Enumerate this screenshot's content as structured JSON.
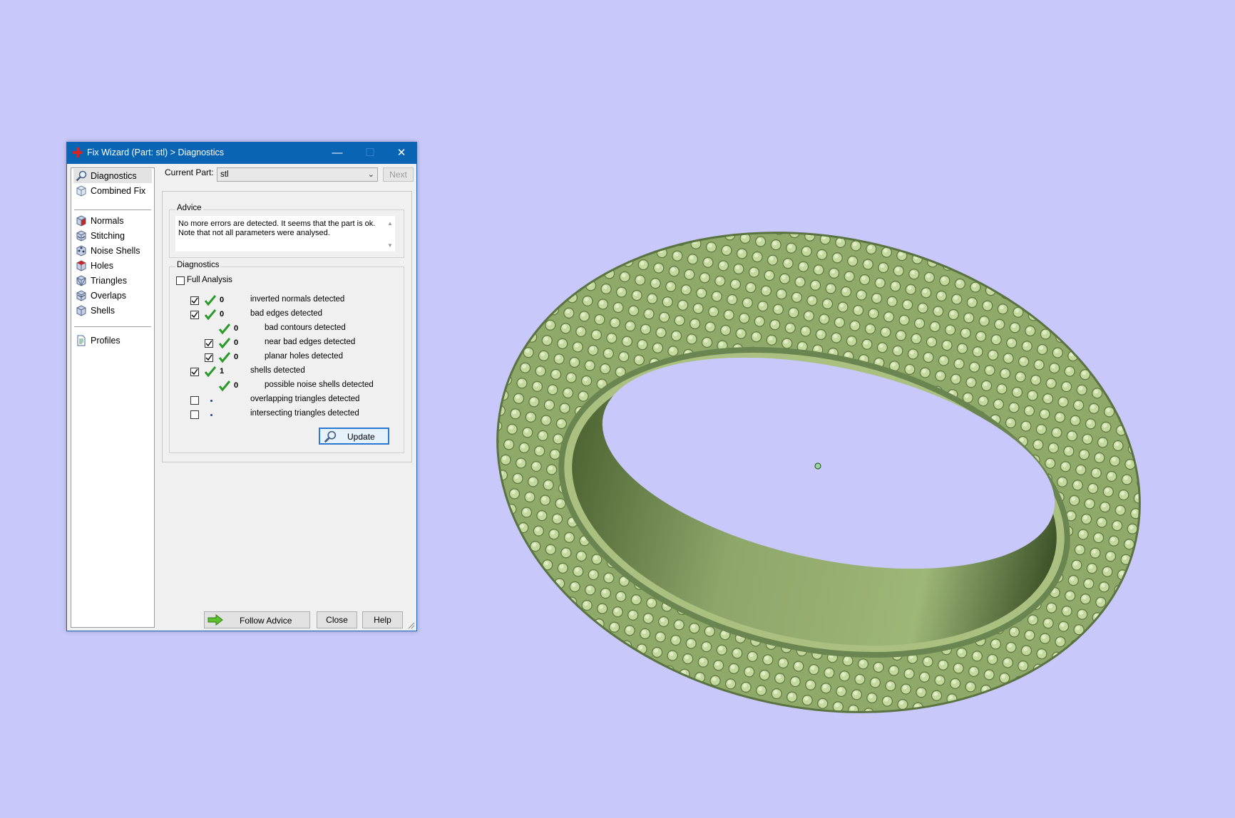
{
  "window": {
    "title": "Fix Wizard (Part: stl) > Diagnostics",
    "min_symbol": "—",
    "max_symbol": "☐",
    "close_symbol": "✕"
  },
  "nav": {
    "items": [
      {
        "label": "Diagnostics",
        "icon": "magnifier-icon",
        "selected": true
      },
      {
        "label": "Combined Fix",
        "icon": "combined-fix-cube-icon"
      },
      {
        "label": "Normals",
        "icon": "normals-cube-icon"
      },
      {
        "label": "Stitching",
        "icon": "stitching-cube-icon"
      },
      {
        "label": "Noise Shells",
        "icon": "noise-shells-cube-icon"
      },
      {
        "label": "Holes",
        "icon": "holes-cube-icon"
      },
      {
        "label": "Triangles",
        "icon": "triangles-cube-icon"
      },
      {
        "label": "Overlaps",
        "icon": "overlaps-cube-icon"
      },
      {
        "label": "Shells",
        "icon": "shells-cube-icon"
      },
      {
        "label": "Profiles",
        "icon": "profiles-document-icon"
      }
    ]
  },
  "current_part": {
    "label": "Current Part:",
    "value": "stl",
    "next_label": "Next"
  },
  "advice": {
    "title": "Advice",
    "text": "No more errors are detected. It seems that the part is ok. Note that not all parameters were analysed."
  },
  "diagnostics": {
    "title": "Diagnostics",
    "full_analysis_label": "Full Analysis",
    "full_analysis_checked": false,
    "rows": [
      {
        "checkbox": true,
        "checked": true,
        "status": "ok",
        "count": "0",
        "label": "inverted normals detected",
        "indent": 0
      },
      {
        "checkbox": true,
        "checked": true,
        "status": "ok",
        "count": "0",
        "label": "bad edges detected",
        "indent": 0
      },
      {
        "checkbox": false,
        "checked": false,
        "status": "ok",
        "count": "0",
        "label": "bad contours detected",
        "indent": 1
      },
      {
        "checkbox": true,
        "checked": true,
        "status": "ok",
        "count": "0",
        "label": "near bad edges detected",
        "indent": 1
      },
      {
        "checkbox": true,
        "checked": true,
        "status": "ok",
        "count": "0",
        "label": "planar holes detected",
        "indent": 1
      },
      {
        "checkbox": true,
        "checked": true,
        "status": "ok",
        "count": "1",
        "label": "shells detected",
        "indent": 0
      },
      {
        "checkbox": false,
        "checked": false,
        "status": "ok",
        "count": "0",
        "label": "possible noise shells detected",
        "indent": 1
      },
      {
        "checkbox": true,
        "checked": false,
        "status": "dot",
        "count": "",
        "label": "overlapping triangles detected",
        "indent": 0
      },
      {
        "checkbox": true,
        "checked": false,
        "status": "dot",
        "count": "",
        "label": "intersecting triangles detected",
        "indent": 0
      }
    ],
    "update_label": "Update"
  },
  "footer": {
    "follow_advice_label": "Follow Advice",
    "close_label": "Close",
    "help_label": "Help"
  },
  "colors": {
    "background": "#c8c8fa",
    "titlebar": "#0a64b4",
    "ring": "#9fb877",
    "check": "#2a9a2a"
  }
}
